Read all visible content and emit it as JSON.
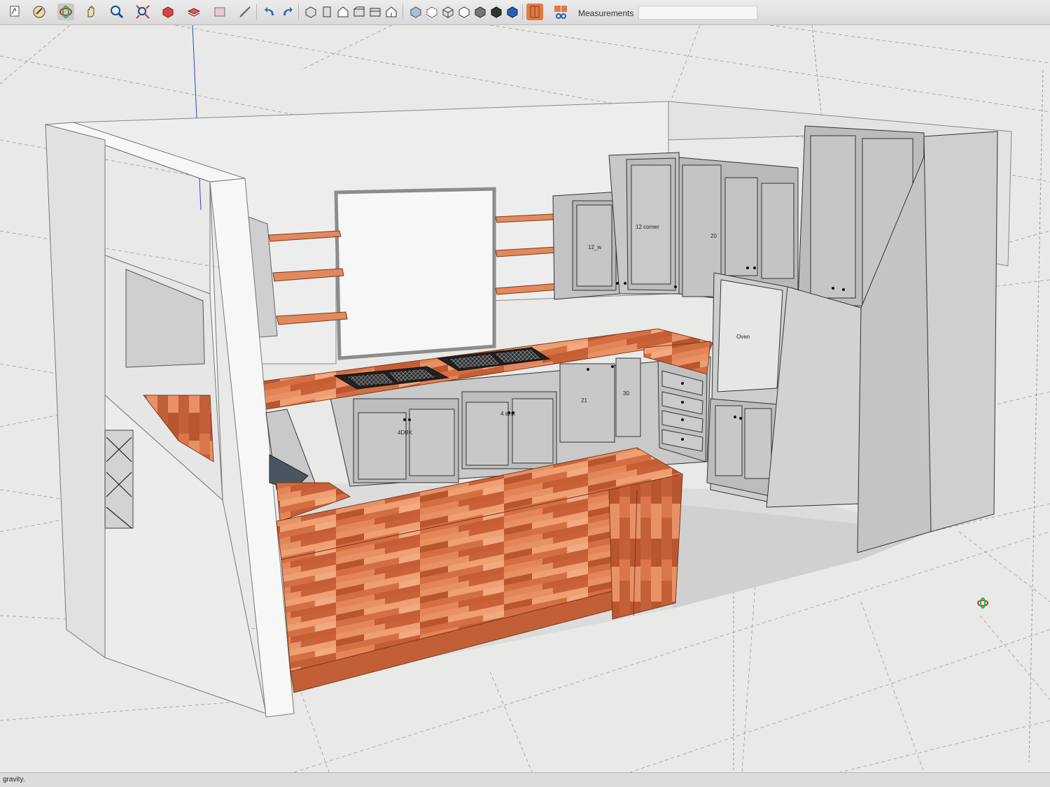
{
  "toolbar": {
    "measurements_label": "Measurements",
    "measurements_value": "",
    "tools": [
      "select-tool-icon",
      "paint-bucket-icon",
      "orbit-icon",
      "pan-icon",
      "zoom-icon",
      "zoom-extents-icon",
      "components-icon",
      "materials-icon",
      "styles-icon",
      "tape-measure-icon",
      "undo-icon",
      "redo-icon",
      "iso-view-icon",
      "top-view-icon",
      "front-view-icon",
      "right-view-icon",
      "back-view-icon",
      "left-view-icon",
      "xray-style-icon",
      "back-edges-style-icon",
      "wireframe-style-icon",
      "hidden-line-style-icon",
      "shaded-style-icon",
      "textured-style-icon",
      "monochrome-style-icon",
      "section-plane-icon",
      "section-cut-icon"
    ]
  },
  "model": {
    "labels": {
      "upper_corner": "12 corner",
      "upper_small": "12_w",
      "oven": "Oven",
      "sink_base": "4DBK",
      "base_mid": "4 sink",
      "base_narrow": "21",
      "base_30": "30",
      "upper_20": "20"
    }
  },
  "status": {
    "text": "gravity."
  },
  "colors": {
    "wood": "#d9774a",
    "cabinet": "#bdbdbd",
    "wall": "#efefef",
    "ground": "#e9e9e7"
  }
}
